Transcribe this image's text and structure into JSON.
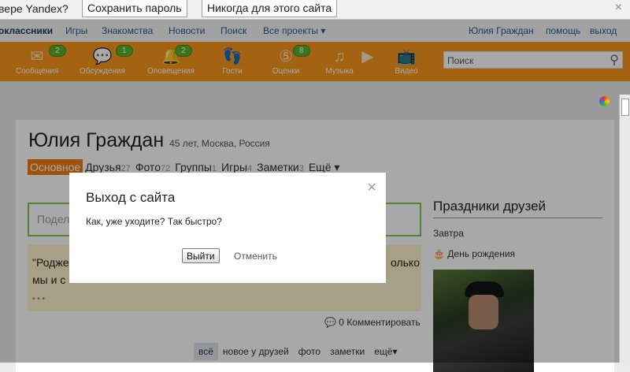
{
  "yandex_bar": {
    "question": "вере Yandex?",
    "save": "Сохранить пароль",
    "never": "Никогда для этого сайта",
    "close": "×"
  },
  "nav": {
    "items": [
      "оклассники",
      "Игры",
      "Знакомства",
      "Новости",
      "Поиск",
      "Все проекты ▾"
    ],
    "user": "Юлия Граждан",
    "help": "помощь",
    "logout": "выход"
  },
  "toolbar": {
    "items": [
      {
        "label": "Сообщения",
        "icon": "envelope-icon",
        "badge": "2"
      },
      {
        "label": "Обсуждения",
        "icon": "chat-icon",
        "badge": "1"
      },
      {
        "label": "Оповещения",
        "icon": "bell-icon",
        "badge": "2"
      },
      {
        "label": "Гости",
        "icon": "footprints-icon",
        "badge": ""
      },
      {
        "label": "Оценки",
        "icon": "rating-icon",
        "badge": "8"
      },
      {
        "label": "Музыка",
        "icon": "music-icon",
        "badge": ""
      },
      {
        "label": "Видео",
        "icon": "video-icon",
        "badge": ""
      }
    ],
    "search_placeholder": "Поиск",
    "accent": "#f7961e"
  },
  "profile": {
    "name": "Юлия Граждан",
    "info": "45 лет, Москва, Россия",
    "tabs": [
      {
        "label": "Основное",
        "count": ""
      },
      {
        "label": "Друзья",
        "count": "27"
      },
      {
        "label": "Фото",
        "count": "72"
      },
      {
        "label": "Группы",
        "count": "1"
      },
      {
        "label": "Игры",
        "count": "4"
      },
      {
        "label": "Заметки",
        "count": "3"
      },
      {
        "label": "Ещё ▾",
        "count": ""
      }
    ]
  },
  "feed": {
    "share_placeholder": "Подел",
    "quote_start": "\"Родже",
    "quote_end": "олько",
    "quote_line2": "мы и с",
    "more": "• • •",
    "comment": "0 Комментировать",
    "filters": [
      "всё",
      "новое у друзей",
      "фото",
      "заметки",
      "ещё▾"
    ]
  },
  "sidebar": {
    "title": "Праздники друзей",
    "when": "Завтра",
    "event": "День рождения"
  },
  "dialog": {
    "title": "Выход с сайта",
    "message": "Как, уже уходите? Так быстро?",
    "confirm": "Выйти",
    "cancel": "Отменить",
    "close": "×"
  }
}
